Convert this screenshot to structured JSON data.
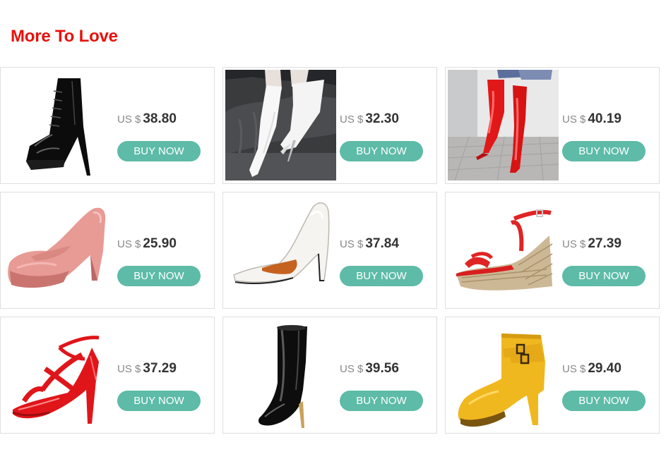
{
  "section_title": "More To Love",
  "currency_label": "US $",
  "buy_label": "BUY NOW",
  "products": [
    {
      "price": "38.80",
      "image": "black-patent-platform-ankle-boot"
    },
    {
      "price": "32.30",
      "image": "white-patent-over-knee-boot"
    },
    {
      "price": "40.19",
      "image": "red-patent-over-knee-boot"
    },
    {
      "price": "25.90",
      "image": "pink-platform-pump"
    },
    {
      "price": "37.84",
      "image": "white-pointed-stiletto-pump"
    },
    {
      "price": "27.39",
      "image": "red-espadrille-wedge-sandal"
    },
    {
      "price": "37.29",
      "image": "red-strappy-peep-toe-heel"
    },
    {
      "price": "39.56",
      "image": "black-patent-knee-boot"
    },
    {
      "price": "29.40",
      "image": "yellow-buckle-ankle-boot"
    }
  ]
}
